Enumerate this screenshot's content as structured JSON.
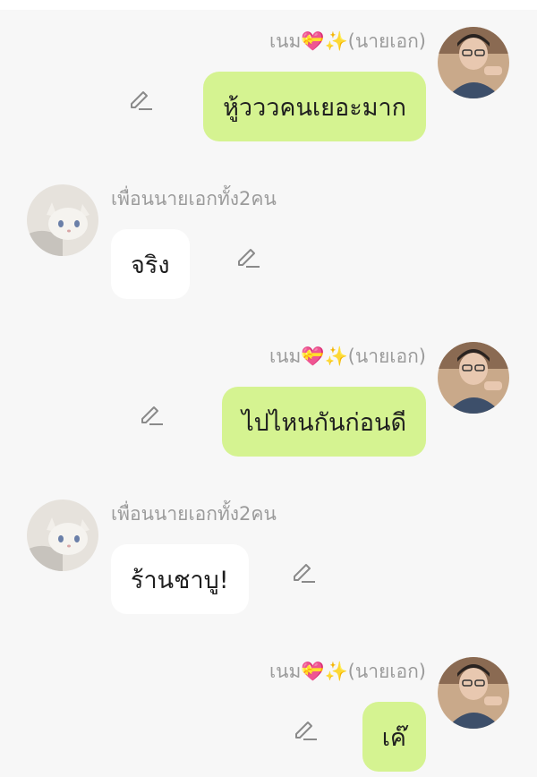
{
  "messages": [
    {
      "sender": "me",
      "name": "เนม💝✨(นายเอก)",
      "text": "หู้วววคนเยอะมาก",
      "avatar": "boy-photo-avatar"
    },
    {
      "sender": "friend",
      "name": "เพื่อนนายเอกทั้ง2คน",
      "text": "จริง",
      "avatar": "white-cat-avatar"
    },
    {
      "sender": "me",
      "name": "เนม💝✨(นายเอก)",
      "text": "ไปไหนกันก่อนดี",
      "avatar": "boy-photo-avatar"
    },
    {
      "sender": "friend",
      "name": "เพื่อนนายเอกทั้ง2คน",
      "text": "ร้านชาบู!",
      "avatar": "white-cat-avatar"
    },
    {
      "sender": "me",
      "name": "เนม💝✨(นายเอก)",
      "text": "เค๊",
      "avatar": "boy-photo-avatar"
    }
  ],
  "icons": {
    "edit": "pencil-edit-icon"
  },
  "colors": {
    "background": "#f7f7f7",
    "my_bubble": "#d5f391",
    "friend_bubble": "#ffffff",
    "name_text": "#9b9b9b"
  }
}
